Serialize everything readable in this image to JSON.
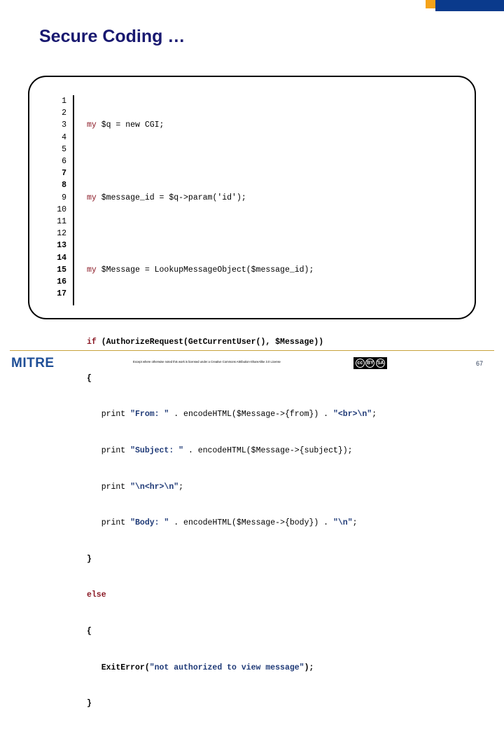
{
  "slide": {
    "title": "Secure Coding …",
    "page_number": "67"
  },
  "decoration": {
    "accent_orange": "#F5A31A",
    "accent_blue": "#0A3A8C",
    "title_color": "#191970",
    "rule_color": "#C8A23C"
  },
  "code_block": {
    "language": "perl",
    "keyword_color": "#8B1A26",
    "string_color": "#1F3A77",
    "line_numbers": [
      {
        "n": "1",
        "bold": false
      },
      {
        "n": "2",
        "bold": false
      },
      {
        "n": "3",
        "bold": false
      },
      {
        "n": "4",
        "bold": false
      },
      {
        "n": "5",
        "bold": false
      },
      {
        "n": "6",
        "bold": false
      },
      {
        "n": "7",
        "bold": true
      },
      {
        "n": "8",
        "bold": true
      },
      {
        "n": "9",
        "bold": false
      },
      {
        "n": "10",
        "bold": false
      },
      {
        "n": "11",
        "bold": false
      },
      {
        "n": "12",
        "bold": false
      },
      {
        "n": "13",
        "bold": true
      },
      {
        "n": "14",
        "bold": true
      },
      {
        "n": "15",
        "bold": true
      },
      {
        "n": "16",
        "bold": true
      },
      {
        "n": "17",
        "bold": true
      }
    ],
    "lines": [
      {
        "n": 1,
        "text": "my $q = new CGI;"
      },
      {
        "n": 2,
        "text": ""
      },
      {
        "n": 3,
        "text": "my $message_id = $q->param('id');"
      },
      {
        "n": 4,
        "text": ""
      },
      {
        "n": 5,
        "text": "my $Message = LookupMessageObject($message_id);"
      },
      {
        "n": 6,
        "text": ""
      },
      {
        "n": 7,
        "text": "if (AuthorizeRequest(GetCurrentUser(), $Message))"
      },
      {
        "n": 8,
        "text": "{"
      },
      {
        "n": 9,
        "text": "   print \"From: \" . encodeHTML($Message->{from}) . \"<br>\\n\";"
      },
      {
        "n": 10,
        "text": "   print \"Subject: \" . encodeHTML($Message->{subject});"
      },
      {
        "n": 11,
        "text": "   print \"\\n<hr>\\n\";"
      },
      {
        "n": 12,
        "text": "   print \"Body: \" . encodeHTML($Message->{body}) . \"\\n\";"
      },
      {
        "n": 13,
        "text": "}"
      },
      {
        "n": 14,
        "text": "else"
      },
      {
        "n": 15,
        "text": "{"
      },
      {
        "n": 16,
        "text": "   ExitError(\"not authorized to view message\");"
      },
      {
        "n": 17,
        "text": "}"
      }
    ]
  },
  "footer": {
    "logo_text": "MITRE",
    "license_text": "Except where otherwise noted this work is licensed under a Creative Commons Attribution-ShareAlike 3.0 License",
    "cc_badge": {
      "marks": [
        "cc",
        "BY",
        "SA"
      ]
    }
  }
}
